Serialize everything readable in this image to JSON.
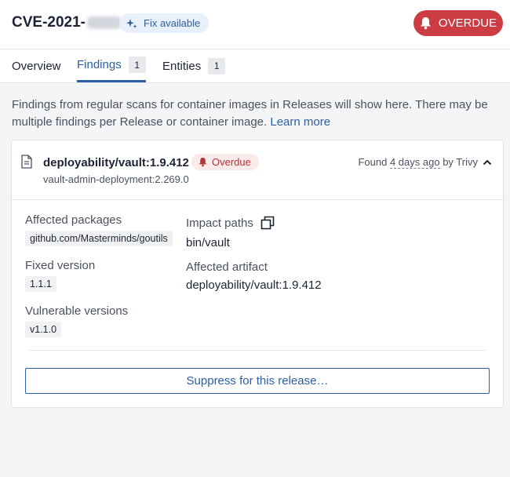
{
  "header": {
    "cve_id": "CVE-2021-",
    "fix_label": "Fix available",
    "overdue_label": "OVERDUE"
  },
  "tabs": [
    {
      "label": "Overview"
    },
    {
      "label": "Findings",
      "count": "1"
    },
    {
      "label": "Entities",
      "count": "1"
    }
  ],
  "intro": {
    "text": "Findings from regular scans for container images in Releases will show here. There may be multiple findings per Release or container image.",
    "link": "Learn more"
  },
  "finding": {
    "artifact": "deployability/vault:1.9.412",
    "status": "Overdue",
    "deployment": "vault-admin-deployment:2.269.0",
    "found_prefix": "Found",
    "found_when": "4 days ago",
    "found_suffix": "by Trivy",
    "affected_packages_label": "Affected packages",
    "affected_packages": "github.com/Masterminds/goutils",
    "fixed_version_label": "Fixed version",
    "fixed_version": "1.1.1",
    "vulnerable_versions_label": "Vulnerable versions",
    "vulnerable_versions": "v1.1.0",
    "impact_paths_label": "Impact paths",
    "impact_path": "bin/vault",
    "affected_artifact_label": "Affected artifact",
    "affected_artifact": "deployability/vault:1.9.412",
    "suppress_label": "Suppress for this release…"
  },
  "colors": {
    "accent": "#2c5fa3",
    "overdue": "#cc3d43",
    "fix_badge_bg": "#e8f0fb"
  }
}
